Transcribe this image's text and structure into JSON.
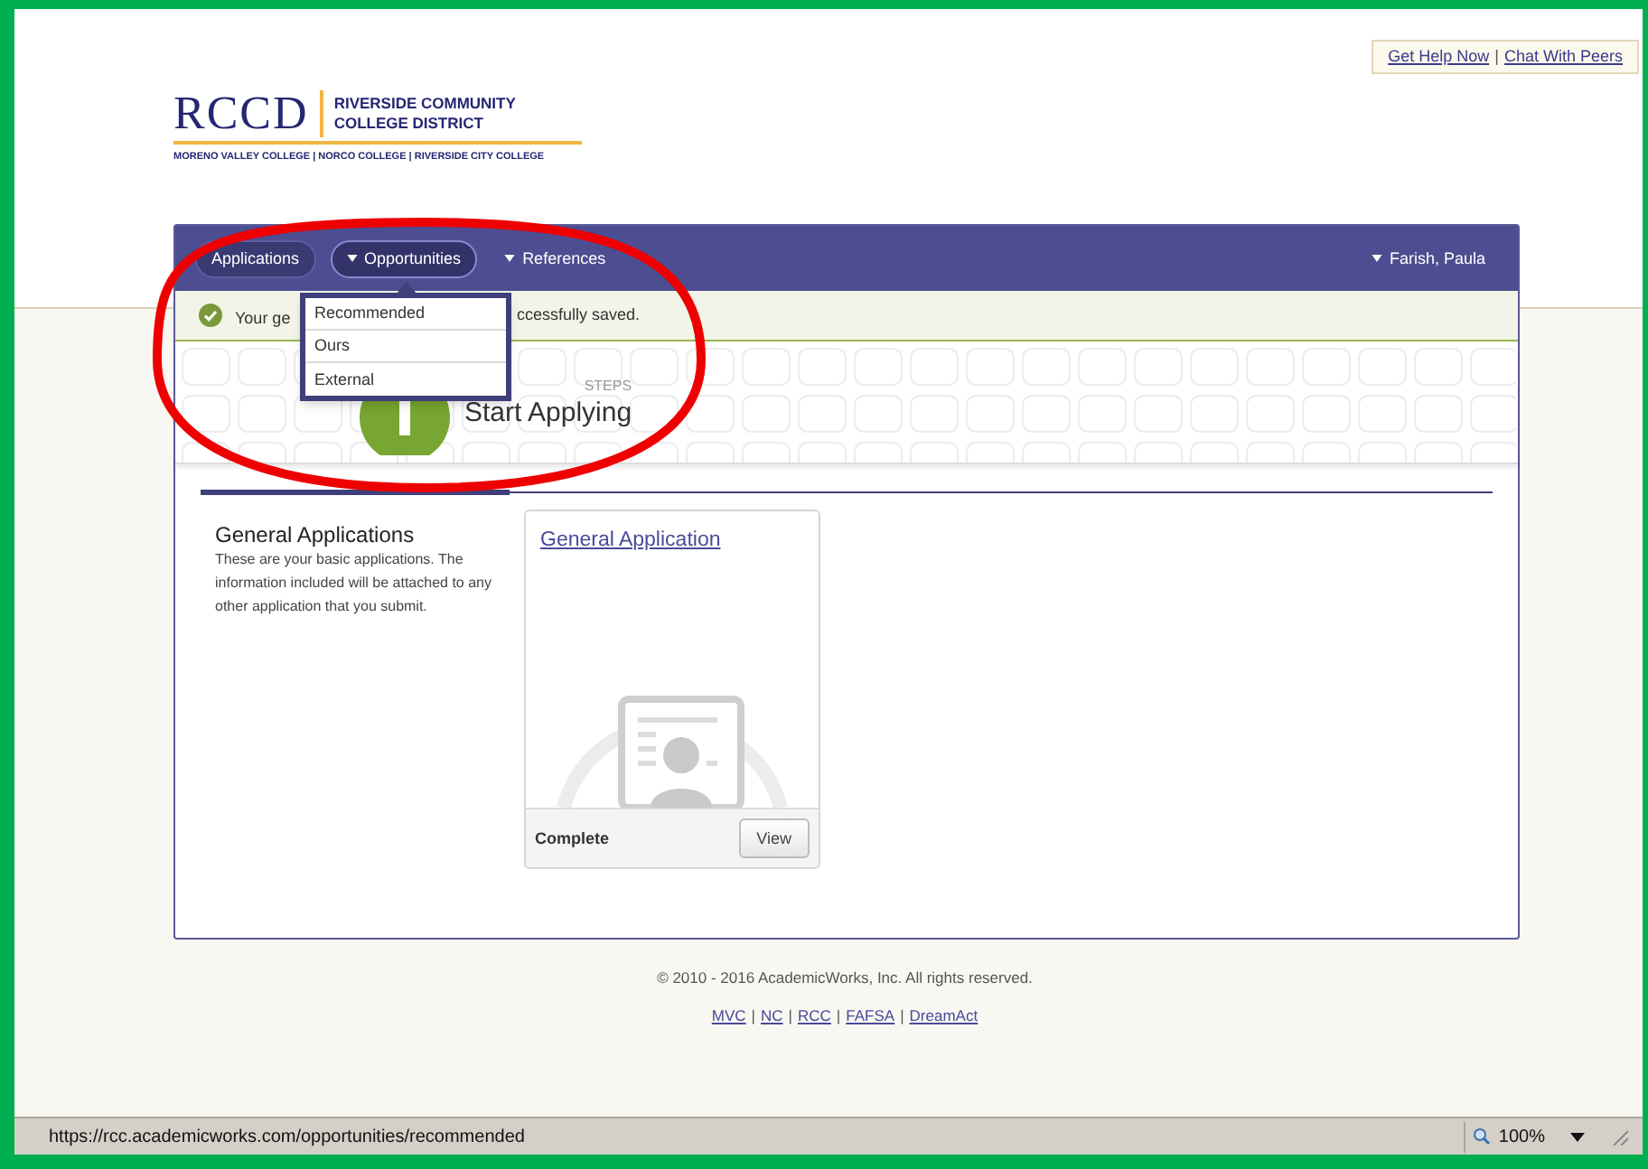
{
  "help_links": {
    "separator": "|",
    "items": [
      "Get Help Now",
      "Chat With Peers"
    ]
  },
  "logo": {
    "mark": "RCCD",
    "name_lines": [
      "RIVERSIDE COMMUNITY",
      "COLLEGE DISTRICT"
    ],
    "colleges": "MORENO VALLEY COLLEGE | NORCO COLLEGE | RIVERSIDE CITY COLLEGE"
  },
  "nav": {
    "items": [
      {
        "label": "Applications",
        "kind": "pill",
        "caret": false,
        "expanded": false
      },
      {
        "label": "Opportunities",
        "kind": "pill",
        "caret": true,
        "expanded": true,
        "menu": [
          "Recommended",
          "Ours",
          "External"
        ]
      },
      {
        "label": "References",
        "kind": "plain",
        "caret": true,
        "expanded": false
      }
    ],
    "user": "Farish, Paula"
  },
  "message": {
    "text_start": "Your ge",
    "text_end": "ccessfully saved."
  },
  "steps": {
    "label": "STEPS",
    "title": "Start Applying"
  },
  "section": {
    "title": "General Applications",
    "description": "These are your basic applications. The information included will be attached to any other application that you submit."
  },
  "card": {
    "title": "General Application",
    "status": "Complete",
    "button": "View"
  },
  "footer": {
    "copyright": "© 2010 - 2016 AcademicWorks, Inc. All rights reserved.",
    "separator": "|",
    "links": [
      "MVC",
      "NC",
      "RCC",
      "FAFSA",
      "DreamAct"
    ]
  },
  "status_bar": {
    "url": "https://rcc.academicworks.com/opportunities/recommended",
    "zoom": "100%"
  }
}
